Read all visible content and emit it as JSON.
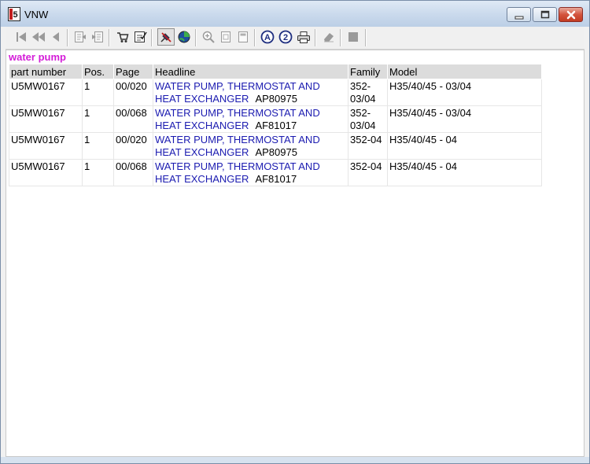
{
  "window": {
    "title": "VNW"
  },
  "search": {
    "term": "water pump"
  },
  "table": {
    "headers": [
      "part number",
      "Pos.",
      "Page",
      "Headline",
      "Family",
      "Model"
    ],
    "rows": [
      {
        "part": "U5MW0167",
        "pos": "1",
        "page": "00/020",
        "headline_line1": "WATER PUMP, THERMOSTAT AND",
        "headline_line2": "HEAT EXCHANGER",
        "code": "AP80975",
        "family_line1": "352-",
        "family_line2": "03/04",
        "model": "H35/40/45 - 03/04"
      },
      {
        "part": "U5MW0167",
        "pos": "1",
        "page": "00/068",
        "headline_line1": "WATER PUMP, THERMOSTAT AND",
        "headline_line2": "HEAT EXCHANGER",
        "code": "AF81017",
        "family_line1": "352-",
        "family_line2": "03/04",
        "model": "H35/40/45 - 03/04"
      },
      {
        "part": "U5MW0167",
        "pos": "1",
        "page": "00/020",
        "headline_line1": "WATER PUMP, THERMOSTAT AND",
        "headline_line2": "HEAT EXCHANGER",
        "code": "AP80975",
        "family_line1": "352-04",
        "family_line2": "",
        "model": "H35/40/45 - 04"
      },
      {
        "part": "U5MW0167",
        "pos": "1",
        "page": "00/068",
        "headline_line1": "WATER PUMP, THERMOSTAT AND",
        "headline_line2": "HEAT EXCHANGER",
        "code": "AF81017",
        "family_line1": "352-04",
        "family_line2": "",
        "model": "H35/40/45 - 04"
      }
    ]
  },
  "toolbar": {
    "icons": [
      "first-page-icon",
      "previous-fast-icon",
      "previous-icon",
      "document-back-icon",
      "document-forward-icon",
      "cart-icon",
      "checklist-icon",
      "pin-tool-icon",
      "globe-icon",
      "zoom-in-icon",
      "page-icon",
      "page-fit-icon",
      "search-a-icon",
      "search-2-icon",
      "print-icon",
      "eraser-icon",
      "stop-icon"
    ]
  },
  "colors": {
    "search_title": "#d41cd8",
    "link": "#1b1bb0",
    "header_bg": "#dcdcdc",
    "title_bar": "#c9d9ec",
    "close_button": "#c23b21"
  }
}
